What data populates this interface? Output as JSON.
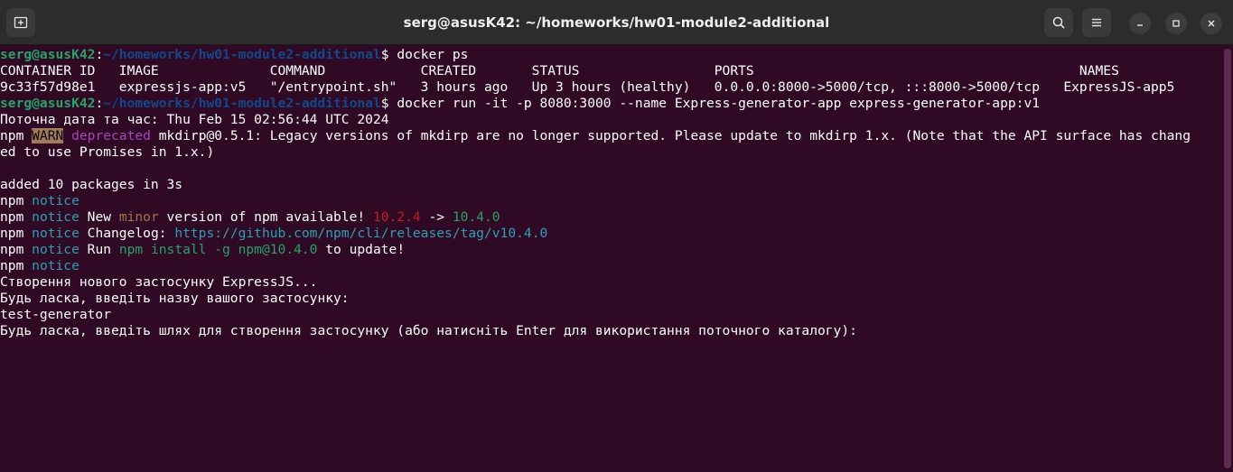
{
  "window": {
    "title": "serg@asusK42: ~/homeworks/hw01-module2-additional",
    "icons": [
      "new-tab-icon",
      "search-icon",
      "menu-icon",
      "minimize-icon",
      "maximize-icon",
      "close-icon"
    ]
  },
  "colors": {
    "background": "#300a24",
    "prompt_user": "#26a269",
    "prompt_path": "#12488b",
    "warn_bg": "#a27b5a",
    "deprecated": "#a347ba",
    "notice": "#2aa1b3",
    "minor": "#a2734c",
    "old_version": "#c01c28",
    "new_version": "#26a269"
  },
  "terminal": {
    "prompt_user": "serg@asusK42",
    "prompt_colon": ":",
    "prompt_path": "~/homeworks/hw01-module2-additional",
    "prompt_dollar": "$ ",
    "cmd1": "docker ps",
    "ps_header": "CONTAINER ID   IMAGE              COMMAND            CREATED       STATUS                 PORTS                                         NAMES",
    "ps_row": "9c33f57d98e1   expressjs-app:v5   \"/entrypoint.sh\"   3 hours ago   Up 3 hours (healthy)   0.0.0.0:8000->5000/tcp, :::8000->5000/tcp   ExpressJS-app5",
    "cmd2": "docker run -it -p 8080:3000 --name Express-generator-app express-generator-app:v1",
    "date_line": "Поточна дата та час: Thu Feb 15 02:56:44 UTC 2024",
    "npm": "npm",
    "warn": "WARN",
    "deprecated": "deprecated",
    "deprecated_msg": " mkdirp@0.5.1: Legacy versions of mkdirp are no longer supported. Please update to mkdirp 1.x. (Note that the API surface has chang",
    "deprecated_cont": "ed to use Promises in 1.x.)",
    "added": "added 10 packages in 3s",
    "notice": "notice",
    "new_text": " New ",
    "minor": "minor",
    "available_text": " version of npm available! ",
    "old_version": "10.2.4",
    "arrow": " -> ",
    "new_version": "10.4.0",
    "changelog_text": " Changelog: ",
    "changelog_url": "https://github.com/npm/cli/releases/tag/v10.4.0",
    "run_text": " Run ",
    "install_cmd": "npm install -g npm@10.4.0",
    "update_text": " to update!",
    "creating": "Створення нового застосунку ExpressJS...",
    "ask_name": "Будь ласка, введіть назву вашого застосунку:",
    "app_name": "test-generator",
    "ask_path": "Будь ласка, введіть шлях для створення застосунку (або натисніть Enter для використання поточного каталогу):"
  }
}
